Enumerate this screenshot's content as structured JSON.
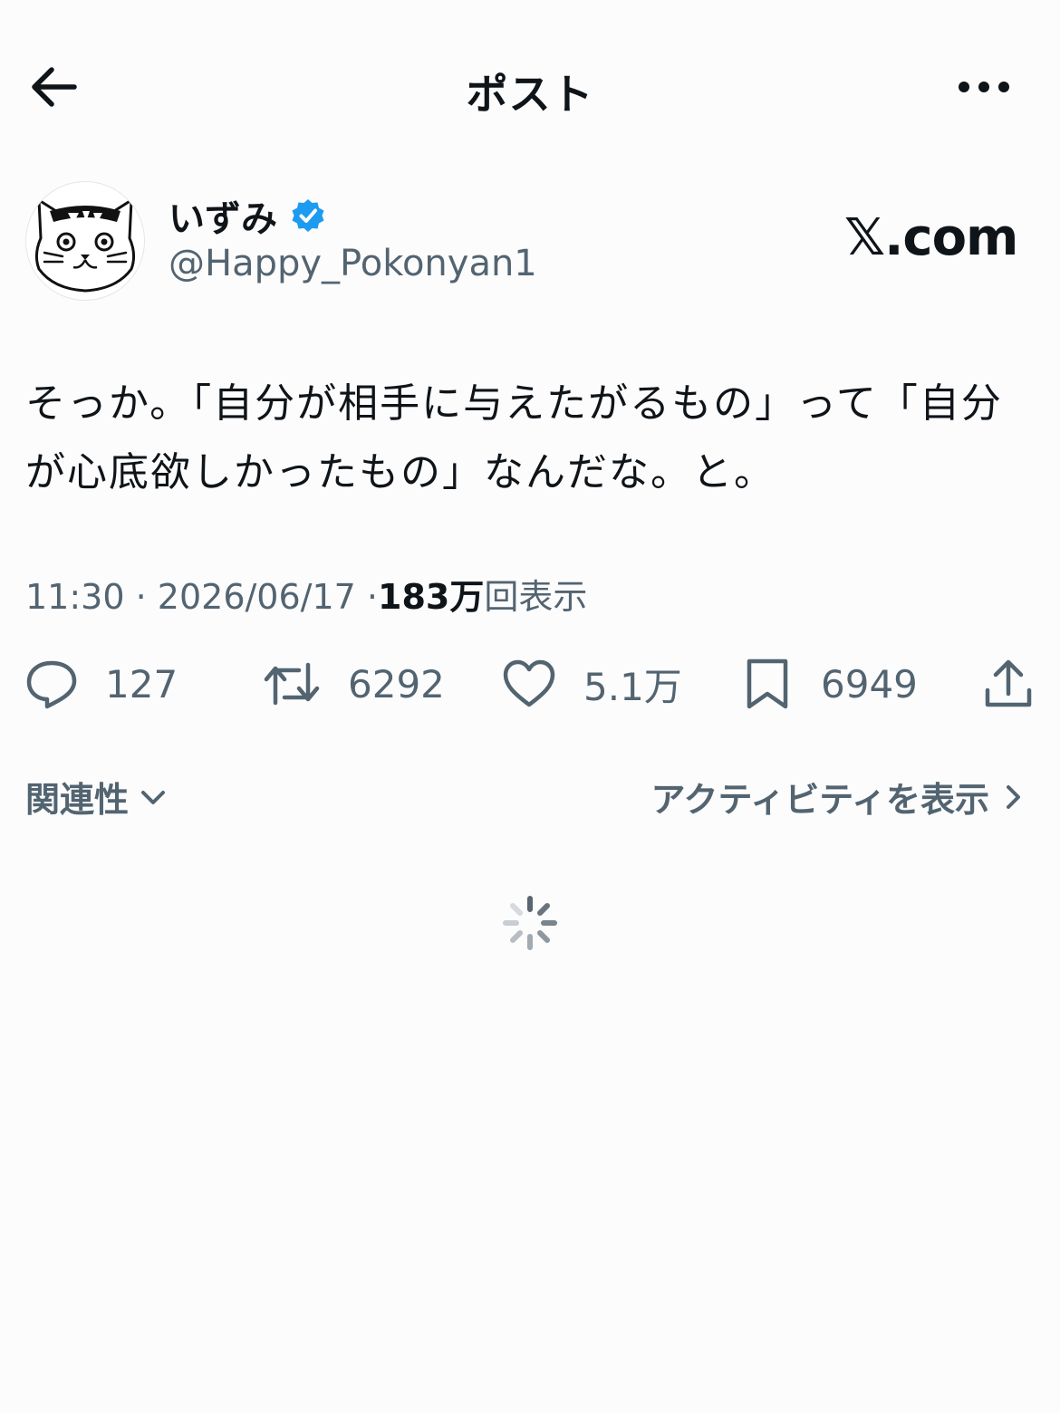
{
  "header": {
    "title": "ポスト",
    "back_icon": "arrow-left-icon",
    "more_icon": "ellipsis-icon"
  },
  "author": {
    "display_name": "いずみ",
    "handle": "@Happy_Pokonyan1",
    "verified": true,
    "verified_color": "#1d9bf0",
    "avatar": "cat-illustration"
  },
  "brand": {
    "label": "𝕏.com"
  },
  "post": {
    "text": "そっか。「自分が相手に与えたがるもの」って「自分が心底欲しかったもの」なんだな。と。"
  },
  "meta": {
    "time": "11:30",
    "separator": "·",
    "date": "2026/06/17",
    "views_count": "183万",
    "views_label": "回表示"
  },
  "actions": {
    "replies": "127",
    "reposts": "6292",
    "likes": "5.1万",
    "bookmarks": "6949"
  },
  "sort": {
    "label": "関連性"
  },
  "activity": {
    "label": "アクティビティを表示"
  },
  "colors": {
    "text_primary": "#0f1419",
    "text_secondary": "#536471",
    "background": "#fcfcfd"
  }
}
